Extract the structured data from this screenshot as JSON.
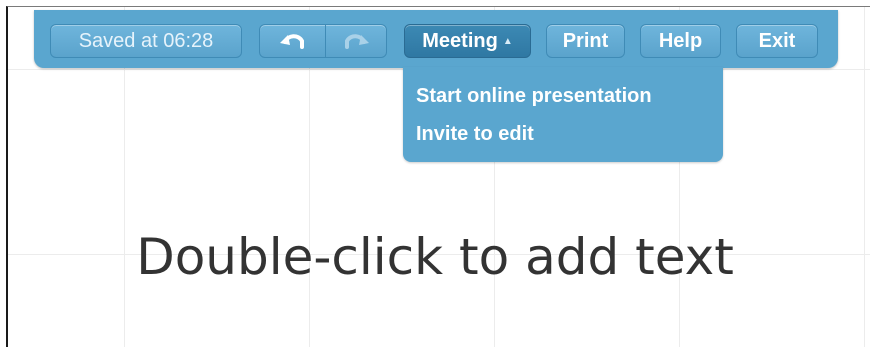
{
  "toolbar": {
    "saved_status": "Saved at 06:28",
    "undo_icon": "undo-arrow-icon",
    "redo_icon": "redo-arrow-icon",
    "meeting_label": "Meeting",
    "print_label": "Print",
    "help_label": "Help",
    "exit_label": "Exit"
  },
  "meeting_menu": {
    "items": [
      {
        "label": "Start online presentation"
      },
      {
        "label": "Invite to edit"
      }
    ]
  },
  "canvas": {
    "placeholder": "Double-click to add text"
  },
  "colors": {
    "toolbar": "#5aa6cf",
    "active_button": "#3c89b4",
    "placeholder_text": "#333333"
  }
}
